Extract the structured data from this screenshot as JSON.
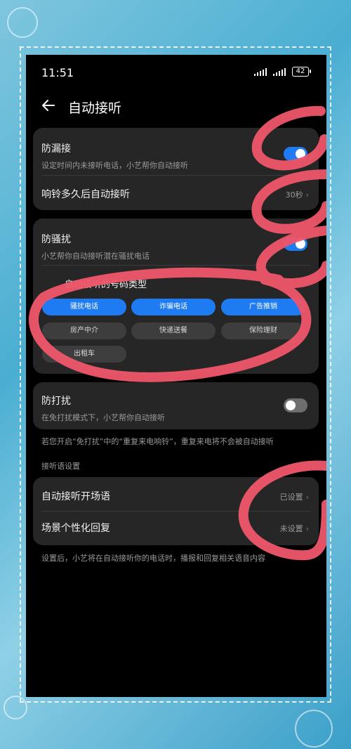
{
  "status_bar": {
    "time": "11:51",
    "battery": "42"
  },
  "header": {
    "title": "自动接听",
    "back_icon": "back-arrow-icon"
  },
  "card1": {
    "leak_title": "防漏接",
    "leak_sub": "设定时间内未接听电话，小艺帮你自动接听",
    "leak_on": true,
    "ring_title": "响铃多久后自动接听",
    "ring_value": "30秒"
  },
  "card2": {
    "harass_title": "防骚扰",
    "harass_sub": "小艺帮你自动接听潜在骚扰电话",
    "harass_on": true,
    "types_label": "自动接听的号码类型",
    "types": [
      {
        "label": "骚扰电话",
        "selected": true
      },
      {
        "label": "诈骗电话",
        "selected": true
      },
      {
        "label": "广告推销",
        "selected": true
      },
      {
        "label": "房产中介",
        "selected": false
      },
      {
        "label": "快递送餐",
        "selected": false
      },
      {
        "label": "保险理财",
        "selected": false
      },
      {
        "label": "出租车",
        "selected": false
      }
    ]
  },
  "card3": {
    "dnd_title": "防打扰",
    "dnd_sub": "在免打扰模式下，小艺帮你自动接听",
    "dnd_on": false
  },
  "dnd_note": "若您开启“免打扰”中的“重复来电响铃”，重复来电将不会被自动接听",
  "greeting_section": "接听语设置",
  "card4": {
    "opening_title": "自动接听开场语",
    "opening_value": "已设置",
    "scene_title": "场景个性化回复",
    "scene_value": "未设置"
  },
  "footer_note": "设置后，小艺将在自动接听你的电话时，播报和回复相关语音内容",
  "colors": {
    "accent": "#1e7bf2",
    "card": "#262626",
    "scribble": "#f0566a"
  }
}
